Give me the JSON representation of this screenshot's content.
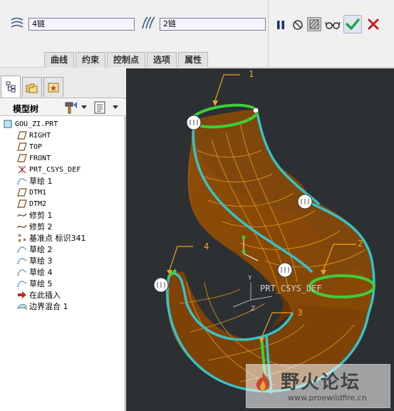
{
  "dashboard": {
    "first_chain": "4链",
    "second_chain": "2链",
    "tabs": [
      {
        "label": "曲线"
      },
      {
        "label": "约束"
      },
      {
        "label": "控制点"
      },
      {
        "label": "选项"
      },
      {
        "label": "属性"
      }
    ],
    "icons": {
      "first_chain": "blend-curves-icon",
      "second_chain": "blend-curves-icon",
      "pause": "pause-icon",
      "no_preview": "no-preview-icon",
      "preview": "preview-icon",
      "glasses": "verify-glasses-icon",
      "ok": "checkmark-icon",
      "cancel": "x-cancel-icon"
    },
    "colors": {
      "ok": "#1fa14a",
      "cancel": "#cc1a1a",
      "field_bg": "#f7f2ff"
    }
  },
  "model_tree": {
    "title": "模型树",
    "items": [
      {
        "label": "GOU_ZI.PRT",
        "icon": "part-icon"
      },
      {
        "label": "RIGHT",
        "icon": "datum-plane-icon"
      },
      {
        "label": "TOP",
        "icon": "datum-plane-icon"
      },
      {
        "label": "FRONT",
        "icon": "datum-plane-icon"
      },
      {
        "label": "PRT_CSYS_DEF",
        "icon": "csys-icon"
      },
      {
        "label": "草绘 1",
        "icon": "sketch-icon"
      },
      {
        "label": "DTM1",
        "icon": "datum-plane-icon"
      },
      {
        "label": "DTM2",
        "icon": "datum-plane-icon"
      },
      {
        "label": "修剪 1",
        "icon": "trim-icon"
      },
      {
        "label": "修剪 2",
        "icon": "trim-icon"
      },
      {
        "label": "基准点 标识341",
        "icon": "datum-point-icon"
      },
      {
        "label": "草绘 2",
        "icon": "sketch-icon"
      },
      {
        "label": "草绘 3",
        "icon": "sketch-icon"
      },
      {
        "label": "草绘 4",
        "icon": "sketch-icon"
      },
      {
        "label": "草绘 5",
        "icon": "sketch-icon"
      },
      {
        "label": "在此插入",
        "icon": "insert-arrow-icon"
      },
      {
        "label": "边界混合 1",
        "icon": "boundary-blend-icon"
      }
    ]
  },
  "viewport": {
    "labels": {
      "l1": "1",
      "l2": "2",
      "l3": "3",
      "l4": "4"
    },
    "csys_label": "PRT_CSYS_DEF",
    "watermark": {
      "title": "野火论坛",
      "url": "www.proewildfire.cn"
    },
    "colors": {
      "background": "#2c3033",
      "surface": "#8a4a08",
      "chain": "#35c3c8",
      "selected": "#3ccf3a",
      "leader": "#f0a020"
    }
  }
}
